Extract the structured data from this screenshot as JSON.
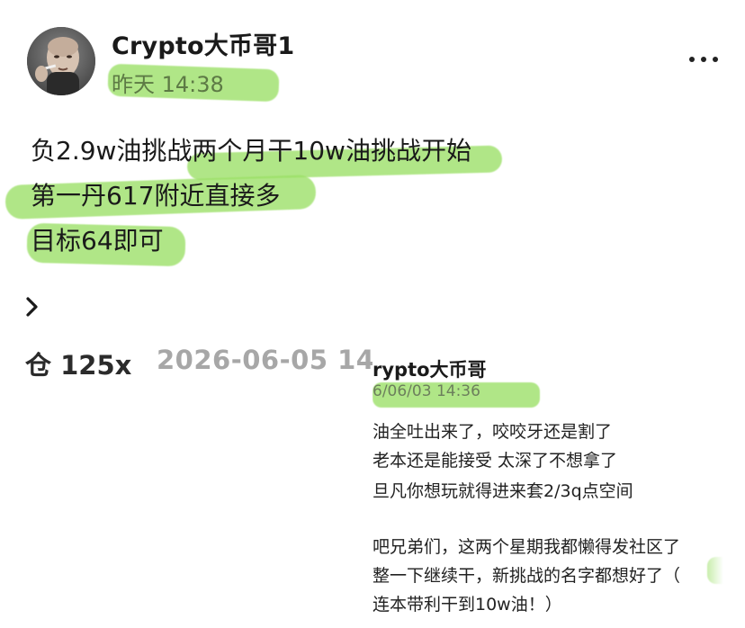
{
  "post": {
    "author": "Crypto大币哥1",
    "time": "昨天 14:38",
    "lines": [
      "负2.9w油挑战两个月干10w油挑战开始",
      "第一丹617附近直接多",
      "目标64即可"
    ]
  },
  "trade": {
    "leverage": "仓 125x",
    "date": "2026-06-05 14"
  },
  "embedded": {
    "author": "rypto大币哥",
    "time": "6/06/03 14:36",
    "lines": [
      "油全吐出来了，咬咬牙还是割了",
      "老本还是能接受 太深了不想拿了",
      "旦凡你想玩就得进来套2/3q点空间",
      "吧兄弟们，这两个星期我都懒得发社区了",
      "整一下继续干，新挑战的名字都想好了（",
      "连本带利干到10w油！）"
    ]
  },
  "icons": {
    "more": "more-horizontal-icon",
    "expand": "chevron-right-icon"
  },
  "colors": {
    "highlight": "#9be066",
    "muted_text": "#a7a7a7"
  }
}
